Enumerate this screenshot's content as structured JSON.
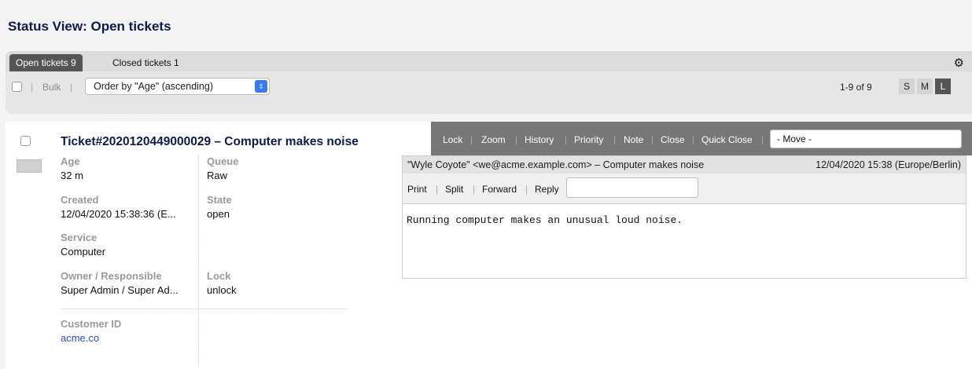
{
  "page": {
    "title": "Status View: Open tickets"
  },
  "tabs": [
    {
      "label": "Open tickets 9"
    },
    {
      "label": "Closed tickets 1"
    }
  ],
  "toolbar": {
    "bulk_label": "Bulk",
    "order_selected": "Order by \"Age\" (ascending)",
    "pager": "1-9 of 9",
    "sizes": [
      "S",
      "M",
      "L"
    ],
    "active_size": "L"
  },
  "ticket": {
    "title": "Ticket#2020120449000029 – Computer makes noise",
    "fields": {
      "age": {
        "label": "Age",
        "value": "32 m"
      },
      "queue": {
        "label": "Queue",
        "value": "Raw"
      },
      "created": {
        "label": "Created",
        "value": "12/04/2020 15:38:36 (E..."
      },
      "state": {
        "label": "State",
        "value": "open"
      },
      "service": {
        "label": "Service",
        "value": "Computer"
      },
      "owner": {
        "label": "Owner / Responsible",
        "value": "Super Admin / Super Ad..."
      },
      "lock": {
        "label": "Lock",
        "value": "unlock"
      },
      "customer_id": {
        "label": "Customer ID",
        "value": "acme.co"
      }
    },
    "actions": [
      "Lock",
      "Zoom",
      "History",
      "Priority",
      "Note",
      "Close",
      "Quick Close"
    ],
    "move_selected": "- Move -"
  },
  "article": {
    "from": "\"Wyle Coyote\" <we@acme.example.com> – Computer makes noise",
    "date": "12/04/2020 15:38 (Europe/Berlin)",
    "actions": [
      "Print",
      "Split",
      "Forward",
      "Reply"
    ],
    "body": "Running computer makes an unusual loud noise."
  }
}
